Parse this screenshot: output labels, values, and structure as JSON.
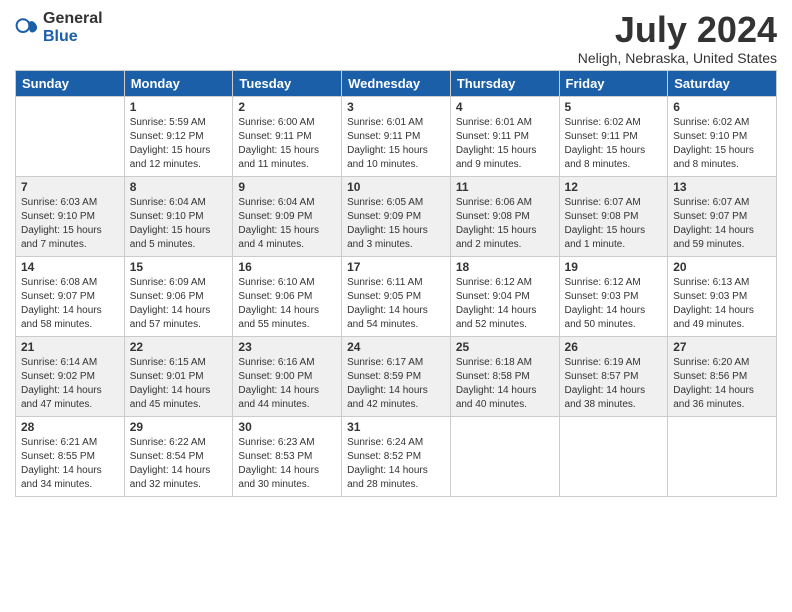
{
  "header": {
    "logo_general": "General",
    "logo_blue": "Blue",
    "title": "July 2024",
    "subtitle": "Neligh, Nebraska, United States"
  },
  "days_of_week": [
    "Sunday",
    "Monday",
    "Tuesday",
    "Wednesday",
    "Thursday",
    "Friday",
    "Saturday"
  ],
  "weeks": [
    [
      {
        "day": "",
        "info": ""
      },
      {
        "day": "1",
        "info": "Sunrise: 5:59 AM\nSunset: 9:12 PM\nDaylight: 15 hours\nand 12 minutes."
      },
      {
        "day": "2",
        "info": "Sunrise: 6:00 AM\nSunset: 9:11 PM\nDaylight: 15 hours\nand 11 minutes."
      },
      {
        "day": "3",
        "info": "Sunrise: 6:01 AM\nSunset: 9:11 PM\nDaylight: 15 hours\nand 10 minutes."
      },
      {
        "day": "4",
        "info": "Sunrise: 6:01 AM\nSunset: 9:11 PM\nDaylight: 15 hours\nand 9 minutes."
      },
      {
        "day": "5",
        "info": "Sunrise: 6:02 AM\nSunset: 9:11 PM\nDaylight: 15 hours\nand 8 minutes."
      },
      {
        "day": "6",
        "info": "Sunrise: 6:02 AM\nSunset: 9:10 PM\nDaylight: 15 hours\nand 8 minutes."
      }
    ],
    [
      {
        "day": "7",
        "info": "Sunrise: 6:03 AM\nSunset: 9:10 PM\nDaylight: 15 hours\nand 7 minutes."
      },
      {
        "day": "8",
        "info": "Sunrise: 6:04 AM\nSunset: 9:10 PM\nDaylight: 15 hours\nand 5 minutes."
      },
      {
        "day": "9",
        "info": "Sunrise: 6:04 AM\nSunset: 9:09 PM\nDaylight: 15 hours\nand 4 minutes."
      },
      {
        "day": "10",
        "info": "Sunrise: 6:05 AM\nSunset: 9:09 PM\nDaylight: 15 hours\nand 3 minutes."
      },
      {
        "day": "11",
        "info": "Sunrise: 6:06 AM\nSunset: 9:08 PM\nDaylight: 15 hours\nand 2 minutes."
      },
      {
        "day": "12",
        "info": "Sunrise: 6:07 AM\nSunset: 9:08 PM\nDaylight: 15 hours\nand 1 minute."
      },
      {
        "day": "13",
        "info": "Sunrise: 6:07 AM\nSunset: 9:07 PM\nDaylight: 14 hours\nand 59 minutes."
      }
    ],
    [
      {
        "day": "14",
        "info": "Sunrise: 6:08 AM\nSunset: 9:07 PM\nDaylight: 14 hours\nand 58 minutes."
      },
      {
        "day": "15",
        "info": "Sunrise: 6:09 AM\nSunset: 9:06 PM\nDaylight: 14 hours\nand 57 minutes."
      },
      {
        "day": "16",
        "info": "Sunrise: 6:10 AM\nSunset: 9:06 PM\nDaylight: 14 hours\nand 55 minutes."
      },
      {
        "day": "17",
        "info": "Sunrise: 6:11 AM\nSunset: 9:05 PM\nDaylight: 14 hours\nand 54 minutes."
      },
      {
        "day": "18",
        "info": "Sunrise: 6:12 AM\nSunset: 9:04 PM\nDaylight: 14 hours\nand 52 minutes."
      },
      {
        "day": "19",
        "info": "Sunrise: 6:12 AM\nSunset: 9:03 PM\nDaylight: 14 hours\nand 50 minutes."
      },
      {
        "day": "20",
        "info": "Sunrise: 6:13 AM\nSunset: 9:03 PM\nDaylight: 14 hours\nand 49 minutes."
      }
    ],
    [
      {
        "day": "21",
        "info": "Sunrise: 6:14 AM\nSunset: 9:02 PM\nDaylight: 14 hours\nand 47 minutes."
      },
      {
        "day": "22",
        "info": "Sunrise: 6:15 AM\nSunset: 9:01 PM\nDaylight: 14 hours\nand 45 minutes."
      },
      {
        "day": "23",
        "info": "Sunrise: 6:16 AM\nSunset: 9:00 PM\nDaylight: 14 hours\nand 44 minutes."
      },
      {
        "day": "24",
        "info": "Sunrise: 6:17 AM\nSunset: 8:59 PM\nDaylight: 14 hours\nand 42 minutes."
      },
      {
        "day": "25",
        "info": "Sunrise: 6:18 AM\nSunset: 8:58 PM\nDaylight: 14 hours\nand 40 minutes."
      },
      {
        "day": "26",
        "info": "Sunrise: 6:19 AM\nSunset: 8:57 PM\nDaylight: 14 hours\nand 38 minutes."
      },
      {
        "day": "27",
        "info": "Sunrise: 6:20 AM\nSunset: 8:56 PM\nDaylight: 14 hours\nand 36 minutes."
      }
    ],
    [
      {
        "day": "28",
        "info": "Sunrise: 6:21 AM\nSunset: 8:55 PM\nDaylight: 14 hours\nand 34 minutes."
      },
      {
        "day": "29",
        "info": "Sunrise: 6:22 AM\nSunset: 8:54 PM\nDaylight: 14 hours\nand 32 minutes."
      },
      {
        "day": "30",
        "info": "Sunrise: 6:23 AM\nSunset: 8:53 PM\nDaylight: 14 hours\nand 30 minutes."
      },
      {
        "day": "31",
        "info": "Sunrise: 6:24 AM\nSunset: 8:52 PM\nDaylight: 14 hours\nand 28 minutes."
      },
      {
        "day": "",
        "info": ""
      },
      {
        "day": "",
        "info": ""
      },
      {
        "day": "",
        "info": ""
      }
    ]
  ]
}
